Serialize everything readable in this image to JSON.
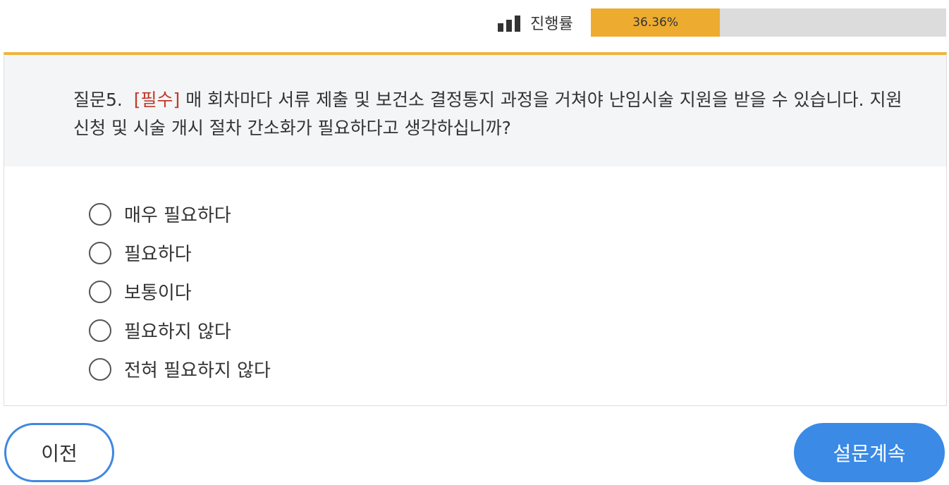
{
  "progress": {
    "label": "진행률",
    "percent_text": "36.36%",
    "fraction": 0.3636
  },
  "question": {
    "number": "질문5.",
    "required": "[필수]",
    "text": "매 회차마다 서류 제출 및 보건소 결정통지 과정을 거쳐야 난임시술 지원을 받을 수 있습니다. 지원 신청 및 시술 개시 절차 간소화가 필요하다고 생각하십니까?"
  },
  "options": [
    {
      "label": "매우 필요하다"
    },
    {
      "label": "필요하다"
    },
    {
      "label": "보통이다"
    },
    {
      "label": "필요하지 않다"
    },
    {
      "label": "전혀 필요하지 않다"
    }
  ],
  "buttons": {
    "prev": "이전",
    "next": "설문계속"
  },
  "colors": {
    "progress_fill": "#edac30",
    "accent_top": "#edb53b",
    "required": "#c0392b",
    "primary_button": "#3a8ae6"
  },
  "icons": {
    "progress": "bar-chart-icon"
  }
}
